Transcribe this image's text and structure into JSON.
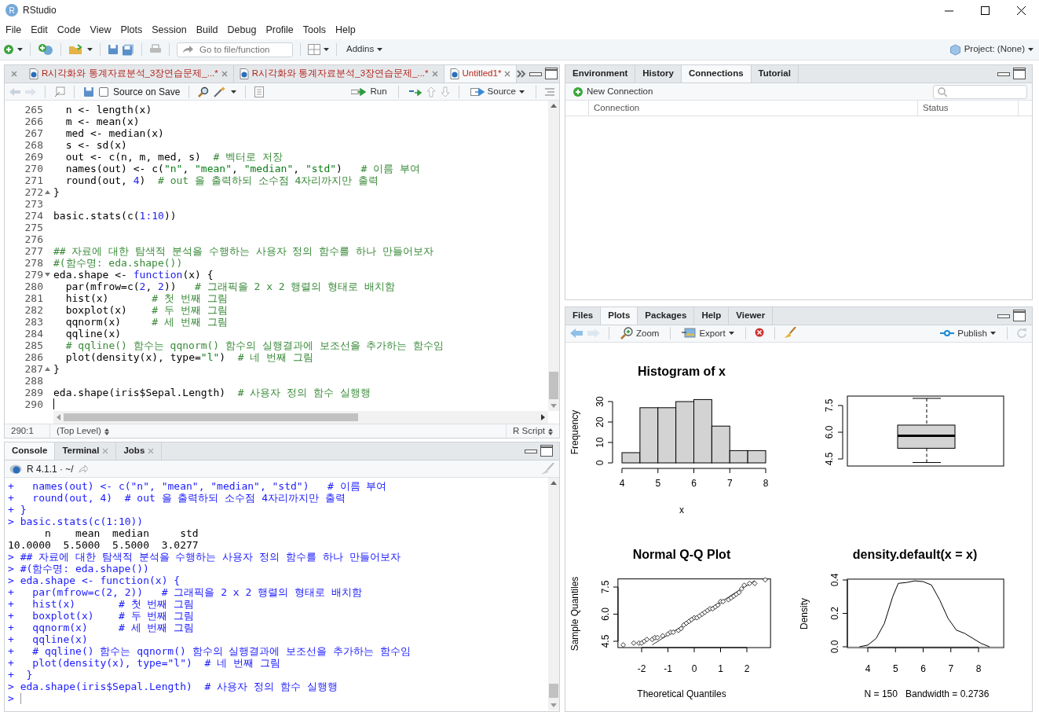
{
  "window": {
    "logo": "R",
    "title": "RStudio"
  },
  "menu": [
    "File",
    "Edit",
    "Code",
    "View",
    "Plots",
    "Session",
    "Build",
    "Debug",
    "Profile",
    "Tools",
    "Help"
  ],
  "toolbar": {
    "goto_placeholder": "Go to file/function",
    "addins": "Addins",
    "project": "Project: (None)"
  },
  "editor": {
    "tabs": [
      {
        "label": "R시각화와 통계자료분석_3장연습문제_...*",
        "unsaved": true,
        "selected": false
      },
      {
        "label": "R시각화와 통계자료분석_3장연습문제_...*",
        "unsaved": true,
        "selected": false
      },
      {
        "label": "Untitled1*",
        "unsaved": true,
        "selected": true
      }
    ],
    "source_on_save": {
      "label": "Source on Save",
      "checked": false
    },
    "run": "Run",
    "source": "Source",
    "lines": [
      {
        "number": "265",
        "tokens": [
          {
            "kind": "code",
            "text": "  n <- length(x)"
          }
        ],
        "cursor": false
      },
      {
        "number": "266",
        "tokens": [
          {
            "kind": "code",
            "text": "  m <- mean(x)"
          }
        ],
        "cursor": false
      },
      {
        "number": "267",
        "tokens": [
          {
            "kind": "code",
            "text": "  med <- median(x)"
          }
        ],
        "cursor": false
      },
      {
        "number": "268",
        "tokens": [
          {
            "kind": "code",
            "text": "  s <- sd(x)"
          }
        ],
        "cursor": false
      },
      {
        "number": "269",
        "tokens": [
          {
            "kind": "code",
            "text": "  out <- c(n, m, med, s)  "
          },
          {
            "kind": "comment",
            "text": "# 벡터로 저장"
          }
        ],
        "cursor": false
      },
      {
        "number": "270",
        "tokens": [
          {
            "kind": "code",
            "text": "  names(out) <- c("
          },
          {
            "kind": "string",
            "text": "\"n\""
          },
          {
            "kind": "code",
            "text": ", "
          },
          {
            "kind": "string",
            "text": "\"mean\""
          },
          {
            "kind": "code",
            "text": ", "
          },
          {
            "kind": "string",
            "text": "\"median\""
          },
          {
            "kind": "code",
            "text": ", "
          },
          {
            "kind": "string",
            "text": "\"std\""
          },
          {
            "kind": "code",
            "text": ")   "
          },
          {
            "kind": "comment",
            "text": "# 이름 부여"
          }
        ],
        "cursor": false
      },
      {
        "number": "271",
        "tokens": [
          {
            "kind": "code",
            "text": "  round(out, "
          },
          {
            "kind": "number",
            "text": "4"
          },
          {
            "kind": "code",
            "text": ")  "
          },
          {
            "kind": "comment",
            "text": "# out 을 출력하되 소수점 4자리까지만 출력"
          }
        ],
        "cursor": false
      },
      {
        "number": "272",
        "tokens": [
          {
            "kind": "code",
            "text": "}"
          }
        ],
        "kind": "fold-end",
        "cursor": false
      },
      {
        "number": "273",
        "cursor": false
      },
      {
        "number": "274",
        "tokens": [
          {
            "kind": "code",
            "text": "basic.stats(c("
          },
          {
            "kind": "number",
            "text": "1:10"
          },
          {
            "kind": "code",
            "text": "))"
          }
        ],
        "cursor": false
      },
      {
        "number": "275",
        "cursor": false
      },
      {
        "number": "276",
        "cursor": false
      },
      {
        "number": "277",
        "tokens": [
          {
            "kind": "comment",
            "text": "## 자료에 대한 탐색적 분석을 수행하는 사용자 정의 함수를 하나 만들어보자"
          }
        ],
        "cursor": false
      },
      {
        "number": "278",
        "tokens": [
          {
            "kind": "comment",
            "text": "#(함수명: eda.shape())"
          }
        ],
        "cursor": false
      },
      {
        "number": "279",
        "tokens": [
          {
            "kind": "code",
            "text": "eda.shape <- "
          },
          {
            "kind": "keyword",
            "text": "function"
          },
          {
            "kind": "code",
            "text": "(x) {"
          }
        ],
        "kind": "fold-start",
        "cursor": false
      },
      {
        "number": "280",
        "tokens": [
          {
            "kind": "code",
            "text": "  par(mfrow=c("
          },
          {
            "kind": "number",
            "text": "2"
          },
          {
            "kind": "code",
            "text": ", "
          },
          {
            "kind": "number",
            "text": "2"
          },
          {
            "kind": "code",
            "text": "))   "
          },
          {
            "kind": "comment",
            "text": "# 그래픽을 2 x 2 행렬의 형태로 배치함"
          }
        ],
        "cursor": false
      },
      {
        "number": "281",
        "tokens": [
          {
            "kind": "code",
            "text": "  hist(x)       "
          },
          {
            "kind": "comment",
            "text": "# 첫 번째 그림"
          }
        ],
        "cursor": false
      },
      {
        "number": "282",
        "tokens": [
          {
            "kind": "code",
            "text": "  boxplot(x)    "
          },
          {
            "kind": "comment",
            "text": "# 두 번째 그림"
          }
        ],
        "cursor": false
      },
      {
        "number": "283",
        "tokens": [
          {
            "kind": "code",
            "text": "  qqnorm(x)     "
          },
          {
            "kind": "comment",
            "text": "# 세 번째 그림"
          }
        ],
        "cursor": false
      },
      {
        "number": "284",
        "tokens": [
          {
            "kind": "code",
            "text": "  qqline(x)"
          }
        ],
        "cursor": false
      },
      {
        "number": "285",
        "tokens": [
          {
            "kind": "comment",
            "text": "  # qqline() 함수는 qqnorm() 함수의 실행결과에 보조선을 추가하는 함수임"
          }
        ],
        "cursor": false
      },
      {
        "number": "286",
        "tokens": [
          {
            "kind": "code",
            "text": "  plot(density(x), type="
          },
          {
            "kind": "string",
            "text": "\"l\""
          },
          {
            "kind": "code",
            "text": ")  "
          },
          {
            "kind": "comment",
            "text": "# 네 번째 그림"
          }
        ],
        "cursor": false
      },
      {
        "number": "287",
        "tokens": [
          {
            "kind": "code",
            "text": "}"
          }
        ],
        "kind": "fold-end",
        "cursor": false
      },
      {
        "number": "288",
        "cursor": false
      },
      {
        "number": "289",
        "tokens": [
          {
            "kind": "code",
            "text": "eda.shape(iris$Sepal.Length)  "
          },
          {
            "kind": "comment",
            "text": "# 사용자 정의 함수 실행행"
          }
        ],
        "cursor": false
      },
      {
        "number": "290",
        "cursor": true
      }
    ],
    "status": {
      "position": "290:1",
      "scope": "(Top Level)",
      "file_type": "R Script"
    }
  },
  "console": {
    "tabs": [
      {
        "label": "Console",
        "selected": true,
        "closable": false
      },
      {
        "label": "Terminal",
        "selected": false,
        "closable": true
      },
      {
        "label": "Jobs",
        "selected": false,
        "closable": true
      }
    ],
    "session": "R 4.1.1 · ~/",
    "lines": [
      {
        "kind": "input",
        "text": "+   names(out) <- c(\"n\", \"mean\", \"median\", \"std\")   # 이름 부여"
      },
      {
        "kind": "input",
        "text": "+   round(out, 4)  # out 을 출력하되 소수점 4자리까지만 출력"
      },
      {
        "kind": "input",
        "text": "+ }"
      },
      {
        "kind": "input",
        "text": "> basic.stats(c(1:10))"
      },
      {
        "kind": "output",
        "text": "      n    mean  median     std"
      },
      {
        "kind": "output",
        "text": "10.0000  5.5000  5.5000  3.0277"
      },
      {
        "kind": "input",
        "text": "> ## 자료에 대한 탐색적 분석을 수행하는 사용자 정의 함수를 하나 만들어보자"
      },
      {
        "kind": "input",
        "text": "> #(함수명: eda.shape())"
      },
      {
        "kind": "input",
        "text": "> eda.shape <- function(x) {"
      },
      {
        "kind": "input",
        "text": "+   par(mfrow=c(2, 2))   # 그래픽을 2 x 2 행렬의 형태로 배치함"
      },
      {
        "kind": "input",
        "text": "+   hist(x)       # 첫 번째 그림"
      },
      {
        "kind": "input",
        "text": "+   boxplot(x)    # 두 번째 그림"
      },
      {
        "kind": "input",
        "text": "+   qqnorm(x)     # 세 번째 그림"
      },
      {
        "kind": "input",
        "text": "+   qqline(x)"
      },
      {
        "kind": "input",
        "text": "+   # qqline() 함수는 qqnorm() 함수의 실행결과에 보조선을 추가하는 함수임"
      },
      {
        "kind": "input",
        "text": "+   plot(density(x), type=\"l\")  # 네 번째 그림"
      },
      {
        "kind": "input",
        "text": "+  }"
      },
      {
        "kind": "input",
        "text": "> eda.shape(iris$Sepal.Length)  # 사용자 정의 함수 실행행"
      },
      {
        "kind": "prompt",
        "text": ">"
      }
    ]
  },
  "environment": {
    "tabs": [
      {
        "label": "Environment",
        "selected": false
      },
      {
        "label": "History",
        "selected": false
      },
      {
        "label": "Connections",
        "selected": true
      },
      {
        "label": "Tutorial",
        "selected": false
      }
    ],
    "new_connection": "New Connection",
    "columns": [
      "Connection",
      "Status"
    ]
  },
  "viewer": {
    "tabs": [
      {
        "label": "Files",
        "selected": false
      },
      {
        "label": "Plots",
        "selected": true
      },
      {
        "label": "Packages",
        "selected": false
      },
      {
        "label": "Help",
        "selected": false
      },
      {
        "label": "Viewer",
        "selected": false
      }
    ],
    "zoom": "Zoom",
    "export": "Export",
    "publish": "Publish",
    "plots": [
      {
        "chart_data": {
          "type": "bar",
          "title": "Histogram of x",
          "xlabel": "x",
          "ylabel": "Frequency",
          "x": [
            4.25,
            4.75,
            5.25,
            5.75,
            6.25,
            6.75,
            7.25,
            7.75
          ],
          "values": [
            5,
            27,
            27,
            30,
            31,
            18,
            6,
            6
          ],
          "xlim": [
            4,
            8
          ],
          "ylim": [
            0,
            32
          ],
          "xticks": [
            4,
            5,
            6,
            7,
            8
          ],
          "yticks": [
            0,
            10,
            20,
            30
          ]
        }
      },
      {
        "kind": "boxplot",
        "tick_labels": [
          "4.5",
          "6.0",
          "7.5"
        ]
      },
      {
        "chart_data": {
          "type": "scatter",
          "title": "Normal Q-Q Plot",
          "xlabel": "Theoretical Quantiles",
          "ylabel": "Sample Quantiles",
          "x": [
            -2.7,
            -2.3,
            -2.1,
            -2.0,
            -1.9,
            -1.8,
            -1.6,
            -1.5,
            -1.4,
            -1.2,
            -1.0,
            -0.9,
            -0.8,
            -0.6,
            -0.5,
            -0.4,
            -0.3,
            -0.2,
            -0.1,
            0.0,
            0.1,
            0.2,
            0.3,
            0.4,
            0.5,
            0.6,
            0.7,
            0.8,
            0.9,
            1.0,
            1.1,
            1.3,
            1.4,
            1.5,
            1.6,
            1.7,
            1.8,
            1.9,
            2.1,
            2.3,
            2.7
          ],
          "series": [
            {
              "values": [
                4.3,
                4.4,
                4.4,
                4.4,
                4.5,
                4.6,
                4.6,
                4.7,
                4.7,
                4.8,
                4.9,
                5.0,
                5.0,
                5.1,
                5.2,
                5.4,
                5.5,
                5.6,
                5.7,
                5.8,
                5.8,
                5.9,
                6.0,
                6.1,
                6.2,
                6.3,
                6.3,
                6.4,
                6.5,
                6.7,
                6.7,
                6.8,
                6.9,
                7.0,
                7.1,
                7.2,
                7.4,
                7.6,
                7.7,
                7.7,
                7.9
              ]
            },
            {
              "type": "line",
              "values": [
                null,
                null,
                null,
                null,
                null,
                null,
                4.3,
                4.39,
                4.48,
                4.67,
                4.85,
                4.94,
                5.03,
                5.21,
                5.3,
                5.4,
                5.49,
                5.58,
                5.67,
                5.76,
                5.85,
                5.94,
                6.03,
                6.12,
                6.22,
                6.31,
                6.4,
                6.49,
                6.58,
                6.67,
                6.76,
                6.94,
                7.04,
                7.13,
                7.22,
                7.31,
                7.4,
                7.49,
                7.67,
                7.86,
                null
              ]
            }
          ],
          "xlim": [
            -2.9,
            2.9
          ],
          "ylim": [
            4.15,
            7.95
          ],
          "xticks": [
            -2,
            -1,
            0,
            1,
            2
          ],
          "yticks": [
            {
              "value": 4.5,
              "label": "4.5"
            },
            {
              "value": 6,
              "label": "6.0"
            },
            {
              "value": 7.5,
              "label": "7.5"
            }
          ]
        }
      },
      {
        "chart_data": {
          "type": "line",
          "title": "density.default(x = x)",
          "xlabel": "N = 150   Bandwidth = 0.2736",
          "ylabel": "Density",
          "x": [
            3.7,
            4.0,
            4.3,
            4.6,
            4.9,
            5.1,
            5.4,
            5.7,
            6.0,
            6.3,
            6.6,
            6.9,
            7.2,
            7.5,
            7.8,
            8.1,
            8.4
          ],
          "values": [
            0.0,
            0.01,
            0.05,
            0.14,
            0.3,
            0.38,
            0.385,
            0.395,
            0.39,
            0.37,
            0.28,
            0.17,
            0.1,
            0.08,
            0.05,
            0.02,
            0.0
          ],
          "xlim": [
            3.26,
            8.91
          ],
          "ylim": [
            -0.005,
            0.405
          ],
          "xticks": [
            4,
            5,
            6,
            7,
            8
          ],
          "yticks": [
            {
              "value": 0,
              "label": "0.0"
            },
            {
              "value": 0.2,
              "label": "0.2"
            },
            {
              "value": 0.4,
              "label": "0.4"
            }
          ]
        }
      }
    ]
  }
}
